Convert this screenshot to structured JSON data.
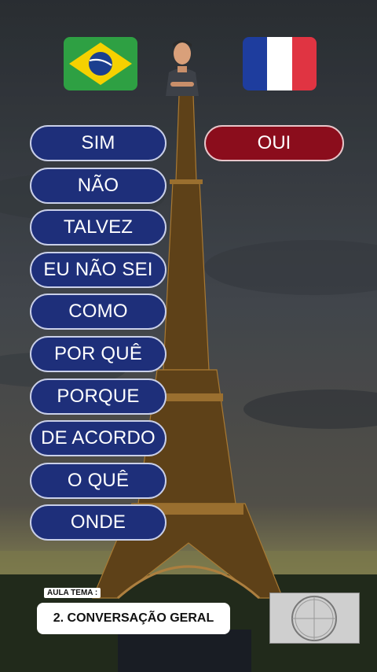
{
  "flags": {
    "source": "brazil-flag",
    "target": "france-flag"
  },
  "words": [
    "SIM",
    "NÃO",
    "TALVEZ",
    "EU NÃO SEI",
    "COMO",
    "POR QUÊ",
    "PORQUE",
    "DE ACORDO",
    "O QUÊ",
    "ONDE"
  ],
  "answer": "OUI",
  "lesson": {
    "tag": "AULA TEMA :",
    "title": "2. CONVERSAÇÃO GERAL"
  },
  "colors": {
    "word_pill": "#1e2f7a",
    "answer_pill": "#8b0d1c",
    "brazil_green": "#2ea043",
    "brazil_yellow": "#f5d100",
    "brazil_blue": "#1b3f8f",
    "france_blue": "#1e3d9e",
    "france_red": "#e03442"
  },
  "background": "eiffel-tower-photo"
}
